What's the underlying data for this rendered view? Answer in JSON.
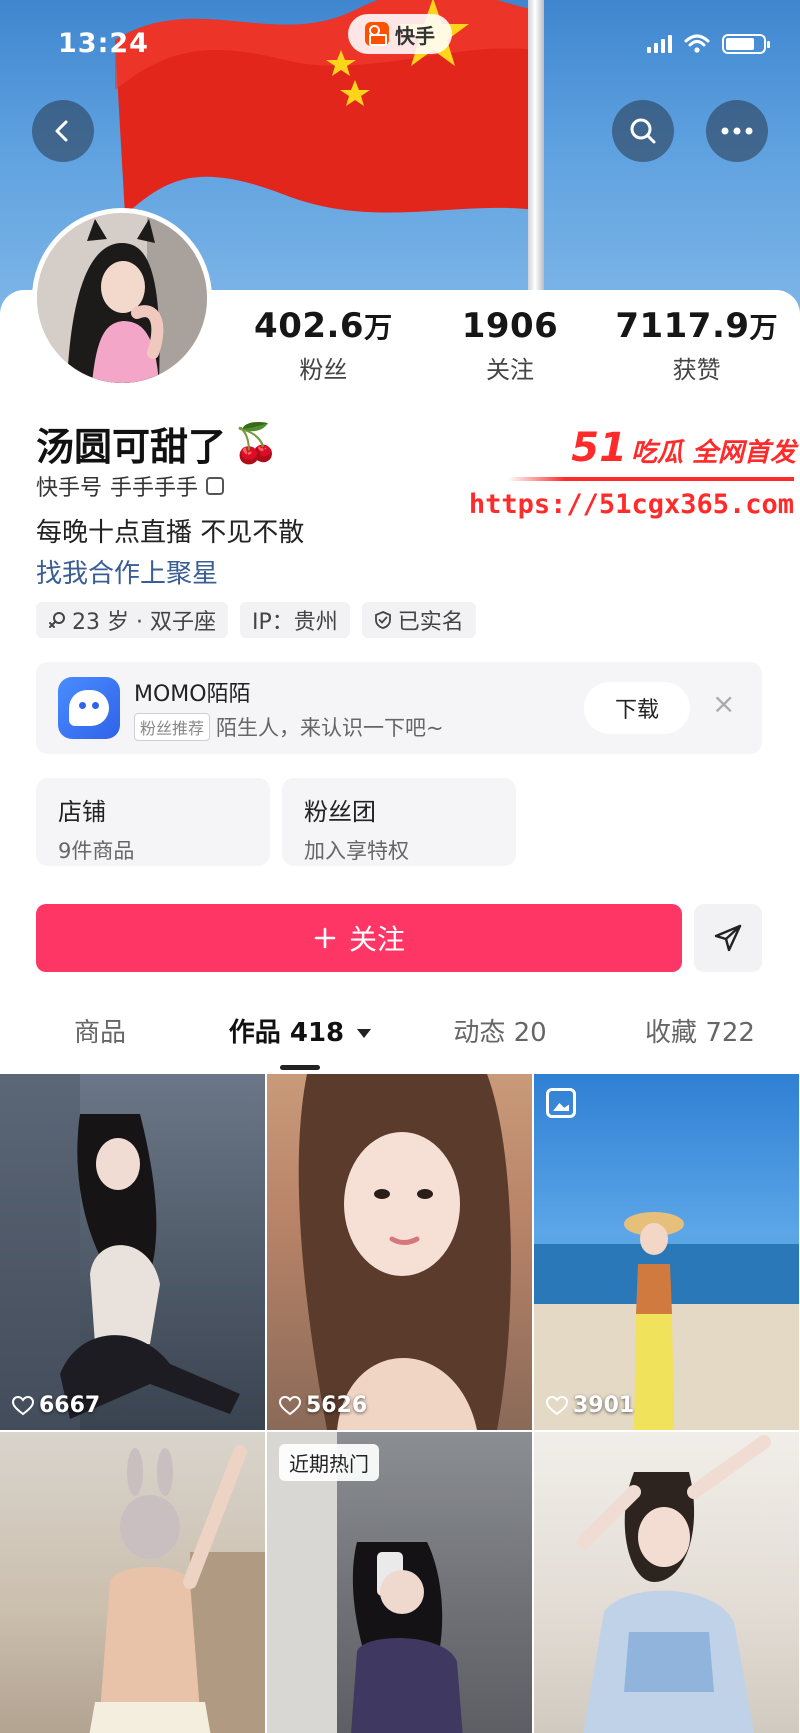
{
  "status_bar": {
    "time": "13:24",
    "app_badge": "快手"
  },
  "profile": {
    "name": "汤圆可甜了",
    "name_emoji": "🍒",
    "uid_label": "快手号",
    "uid_value": "手手手手",
    "bio": "每晚十点直播 不见不散",
    "bio_link": "找我合作上聚星",
    "tags": [
      "23 岁 · 双子座",
      "IP：贵州",
      "已实名"
    ]
  },
  "stats": [
    {
      "value": "402.6",
      "unit": "万",
      "label": "粉丝"
    },
    {
      "value": "1906",
      "unit": "",
      "label": "关注"
    },
    {
      "value": "7117.9",
      "unit": "万",
      "label": "获赞"
    }
  ],
  "ad": {
    "title": "MOMO陌陌",
    "tag": "粉丝推荐",
    "desc": "陌生人，来认识一下吧~",
    "button": "下载",
    "close": "×"
  },
  "features": [
    {
      "title": "店铺",
      "subtitle": "9件商品"
    },
    {
      "title": "粉丝团",
      "subtitle": "加入享特权"
    }
  ],
  "follow_button": "关注",
  "tabs": [
    {
      "label": "商品",
      "count": ""
    },
    {
      "label": "作品",
      "count": "418"
    },
    {
      "label": "动态",
      "count": "20"
    },
    {
      "label": "收藏",
      "count": "722"
    }
  ],
  "grid": [
    {
      "likes": "6667",
      "badge": ""
    },
    {
      "likes": "5626",
      "badge": ""
    },
    {
      "likes": "3901",
      "badge": ""
    },
    {
      "likes": "",
      "badge": ""
    },
    {
      "likes": "",
      "badge": "近期热门"
    },
    {
      "likes": "",
      "badge": ""
    }
  ],
  "watermark": {
    "number": "51",
    "text": "吃瓜 全网首发",
    "url": "https://51cgx365.com"
  }
}
